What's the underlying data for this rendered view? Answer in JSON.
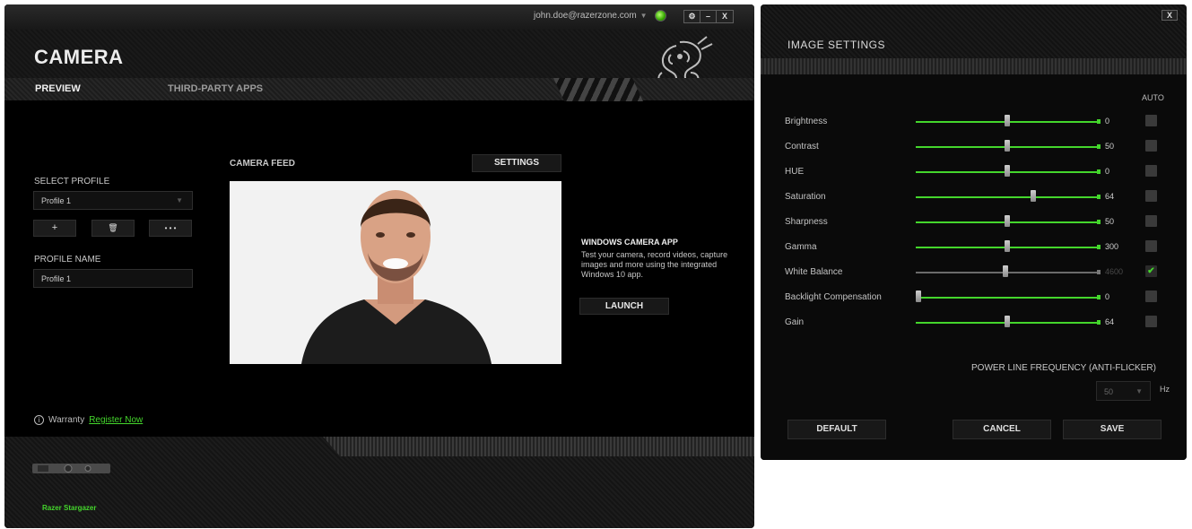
{
  "main_window": {
    "account": "john.doe@razerzone.com",
    "window_buttons": {
      "settings": "⚙",
      "minimize": "–",
      "close": "X"
    },
    "title": "CAMERA",
    "tabs": [
      {
        "label": "PREVIEW",
        "active": true
      },
      {
        "label": "THIRD-PARTY APPS",
        "active": false
      }
    ],
    "profile": {
      "select_label": "SELECT PROFILE",
      "selected": "Profile 1",
      "add_label": "+",
      "delete_label": "🗑",
      "more_label": "• • •",
      "name_label": "PROFILE NAME",
      "name_value": "Profile 1"
    },
    "camera": {
      "feed_label": "CAMERA FEED",
      "settings_button": "SETTINGS"
    },
    "windows_app": {
      "title": "WINDOWS CAMERA APP",
      "description": "Test your camera, record videos, capture images and more using the integrated Windows 10 app.",
      "launch_button": "LAUNCH"
    },
    "warranty": {
      "label": "Warranty",
      "link": "Register Now"
    },
    "device_name": "Razer Stargazer"
  },
  "image_settings": {
    "title": "IMAGE SETTINGS",
    "close": "X",
    "auto_header": "AUTO",
    "rows": [
      {
        "label": "Brightness",
        "value": "0",
        "fraction": 0.5,
        "auto": false,
        "disabled": false
      },
      {
        "label": "Contrast",
        "value": "50",
        "fraction": 0.5,
        "auto": false,
        "disabled": false
      },
      {
        "label": "HUE",
        "value": "0",
        "fraction": 0.5,
        "auto": false,
        "disabled": false
      },
      {
        "label": "Saturation",
        "value": "64",
        "fraction": 0.64,
        "auto": false,
        "disabled": false
      },
      {
        "label": "Sharpness",
        "value": "50",
        "fraction": 0.5,
        "auto": false,
        "disabled": false
      },
      {
        "label": "Gamma",
        "value": "300",
        "fraction": 0.5,
        "auto": false,
        "disabled": false
      },
      {
        "label": "White Balance",
        "value": "4600",
        "fraction": 0.49,
        "auto": true,
        "disabled": true
      },
      {
        "label": "Backlight Compensation",
        "value": "0",
        "fraction": 0.0,
        "auto": false,
        "disabled": false
      },
      {
        "label": "Gain",
        "value": "64",
        "fraction": 0.5,
        "auto": false,
        "disabled": false
      }
    ],
    "power_line": {
      "label": "POWER LINE FREQUENCY (ANTI-FLICKER)",
      "value": "50",
      "unit": "Hz"
    },
    "buttons": {
      "default": "DEFAULT",
      "cancel": "CANCEL",
      "save": "SAVE"
    }
  },
  "colors": {
    "accent": "#44d62c",
    "background": "#0b0b0b"
  }
}
